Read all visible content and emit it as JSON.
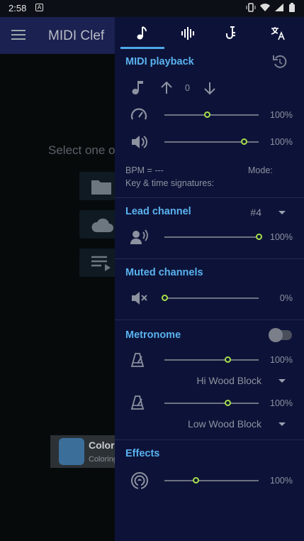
{
  "status_bar": {
    "time": "2:58",
    "notification_letter": "A"
  },
  "app_bar": {
    "title": "MIDI Clef"
  },
  "background": {
    "select_prompt": "Select one of the following options",
    "ad": {
      "title": "Coloring - Paint...",
      "subtitle": "Coloring"
    }
  },
  "panel": {
    "tabs": [
      {
        "name": "music-note",
        "selected": true
      },
      {
        "name": "audio-waveform",
        "selected": false
      },
      {
        "name": "saxophone",
        "selected": false
      },
      {
        "name": "translate",
        "selected": false
      }
    ],
    "midi_playback": {
      "title": "MIDI playback",
      "transpose": "0",
      "speed": {
        "value": "100%",
        "level": 0.45
      },
      "volume": {
        "value": "100%",
        "level": 0.84
      },
      "bpm": "BPM = ---",
      "mode": "Mode:",
      "key_time": "Key & time signatures:"
    },
    "lead_channel": {
      "title": "Lead channel",
      "channel": "#4",
      "volume": {
        "value": "100%",
        "level": 1.0
      }
    },
    "muted_channels": {
      "title": "Muted channels",
      "volume": {
        "value": "0%",
        "level": 0.0
      }
    },
    "metronome": {
      "title": "Metronome",
      "enabled": false,
      "hi_volume": {
        "value": "100%",
        "level": 0.67
      },
      "hi_sound": "Hi Wood Block",
      "low_volume": {
        "value": "100%",
        "level": 0.67
      },
      "low_sound": "Low Wood Block"
    },
    "effects": {
      "title": "Effects",
      "volume": {
        "value": "100%",
        "level": 0.33
      }
    }
  },
  "colors": {
    "accent": "#5ab2f0",
    "thumb": "#a6e04a",
    "panel": "#0d1338",
    "appbar": "#1b2150"
  }
}
